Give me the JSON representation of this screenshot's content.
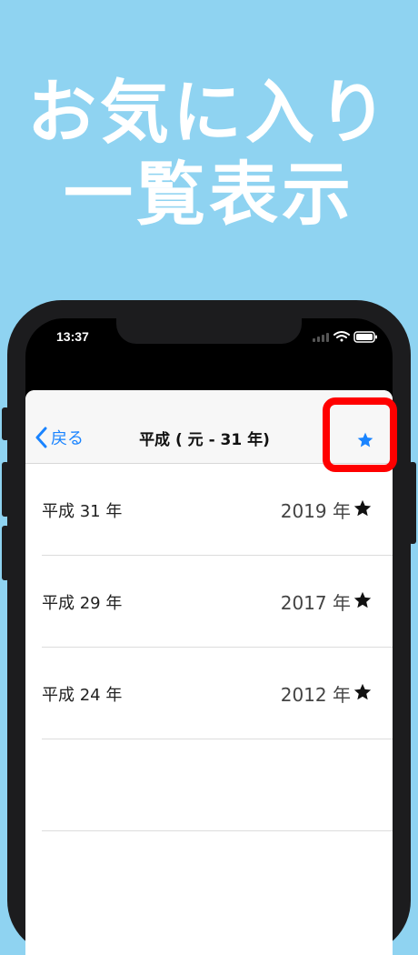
{
  "promo": {
    "line1": "お気に入り",
    "line2": "一覧表示"
  },
  "status_bar": {
    "time": "13:37"
  },
  "navbar": {
    "back_label": "戻る",
    "title": "平成 ( 元 - 31 年)"
  },
  "rows": [
    {
      "label": "平成 31 年",
      "year": "2019 年"
    },
    {
      "label": "平成 29 年",
      "year": "2017 年"
    },
    {
      "label": "平成 24 年",
      "year": "2012 年"
    }
  ],
  "colors": {
    "background": "#8fd3f1",
    "accent": "#1a84ff",
    "highlight": "#ff0000"
  }
}
